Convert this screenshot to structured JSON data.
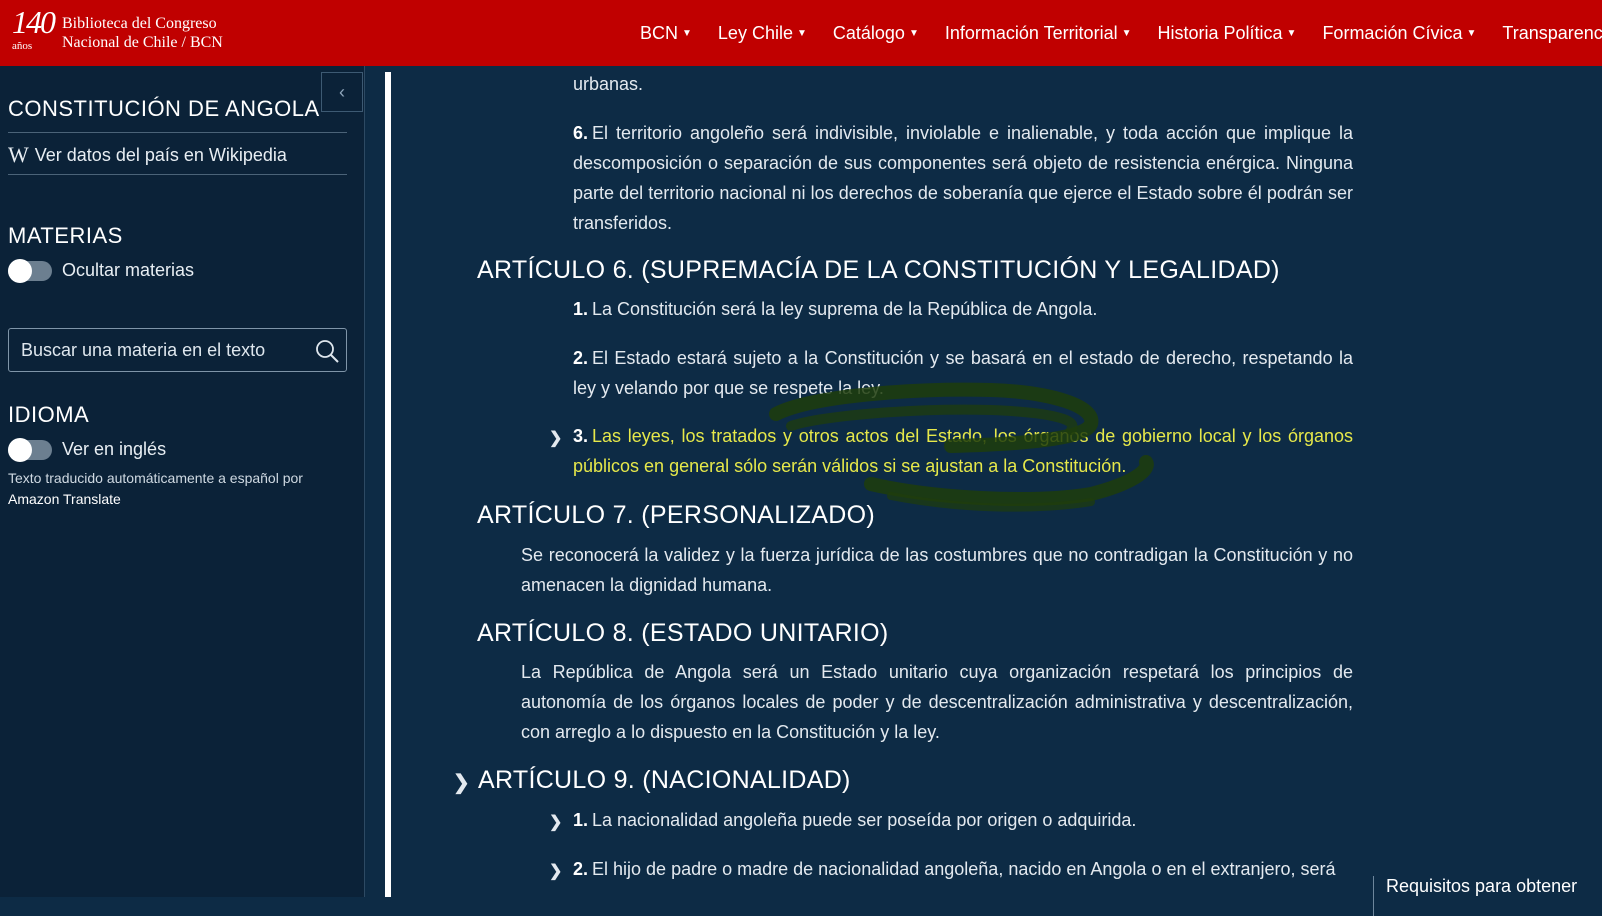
{
  "header": {
    "logo_number": "140",
    "logo_sub": "años",
    "logo_line1": "Biblioteca del Congreso",
    "logo_line2": "Nacional de Chile / BCN",
    "nav": [
      {
        "label": "BCN"
      },
      {
        "label": "Ley Chile"
      },
      {
        "label": "Catálogo"
      },
      {
        "label": "Información Territorial"
      },
      {
        "label": "Historia Política"
      },
      {
        "label": "Formación Cívica"
      },
      {
        "label": "Transparencia"
      }
    ],
    "bar_color": "#c00000"
  },
  "sidebar": {
    "collapse_icon": "chevron-left-icon",
    "title": "CONSTITUCIÓN DE ANGOLA",
    "wiki_icon": "W",
    "wiki_label": "Ver datos del país en Wikipedia",
    "materias_heading": "MATERIAS",
    "materias_toggle_label": "Ocultar materias",
    "search_placeholder": "Buscar una materia en el texto",
    "idioma_heading": "IDIOMA",
    "idioma_toggle_label": "Ver en inglés",
    "translation_note": "Texto traducido automáticamente a español por",
    "translation_brand": "Amazon Translate"
  },
  "content": {
    "p_urbanas": "urbanas.",
    "art5_p6_num": "6.",
    "art5_p6": "El territorio angoleño será indivisible, inviolable e inalienable, y toda acción que implique la descomposición o separación de sus componentes será objeto de resistencia enérgica. Ninguna parte del territorio nacional ni los derechos de soberanía que ejerce el Estado sobre él podrán ser transferidos.",
    "art6_title": "ARTÍCULO 6. (SUPREMACÍA DE LA CONSTITUCIÓN Y LEGALIDAD)",
    "art6_p1_num": "1.",
    "art6_p1": "La Constitución será la ley suprema de la República de Angola.",
    "art6_p2_num": "2.",
    "art6_p2": "El Estado estará sujeto a la Constitución y se basará en el estado de derecho, respetando la ley y velando por que se respete la ley.",
    "art6_p3_num": "3.",
    "art6_p3": "Las leyes, los tratados y otros actos del Estado, los órganos de gobierno local y los órganos públicos en general sólo serán válidos si se ajustan a la Constitución.",
    "art7_title": "ARTÍCULO 7. (PERSONALIZADO)",
    "art7_p": "Se reconocerá la validez y la fuerza jurídica de las costumbres que no contradigan la Constitución y no amenacen la dignidad humana.",
    "art8_title": "ARTÍCULO 8. (ESTADO UNITARIO)",
    "art8_p": "La República de Angola será un Estado unitario cuya organización respetará los principios de autonomía de los órganos locales de poder y de descentralización administrativa y descentralización, con arreglo a lo dispuesto en la Constitución y la ley.",
    "art9_title": "ARTÍCULO 9. (NACIONALIDAD)",
    "art9_p1_num": "1.",
    "art9_p1": "La nacionalidad angoleña puede ser poseída por origen o adquirida.",
    "art9_p2_num": "2.",
    "art9_p2": "El hijo de padre o madre de nacionalidad angoleña, nacido en Angola o en el extranjero, será",
    "side_link": "Requisitos para obtener"
  },
  "colors": {
    "page_bg": "#0d2b45",
    "sidebar_bg": "#0b2238",
    "highlight_text": "#e6e84a",
    "scribble": "#1f3d0c"
  }
}
